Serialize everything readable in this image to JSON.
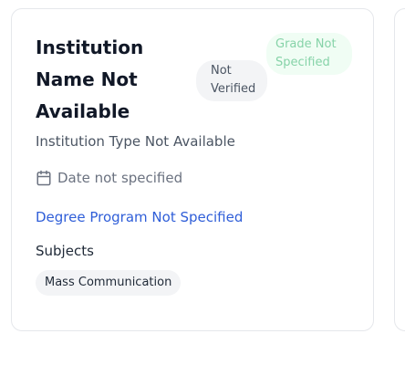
{
  "card": {
    "institution_name": "Institution Name Not Available",
    "verification_status": "Not Verified",
    "grade": "Grade Not Specified",
    "institution_type": "Institution Type Not Available",
    "date": "Date not specified",
    "date_icon": "calendar-icon",
    "degree_program": "Degree Program Not Specified",
    "subjects_label": "Subjects",
    "subjects": [
      "Mass Communication"
    ]
  },
  "colors": {
    "link": "#2f5ed8",
    "grade_text": "#86d3a8",
    "grade_bg": "#f0fdf4",
    "badge_bg": "#f3f4f6",
    "border": "#e5e7eb"
  }
}
